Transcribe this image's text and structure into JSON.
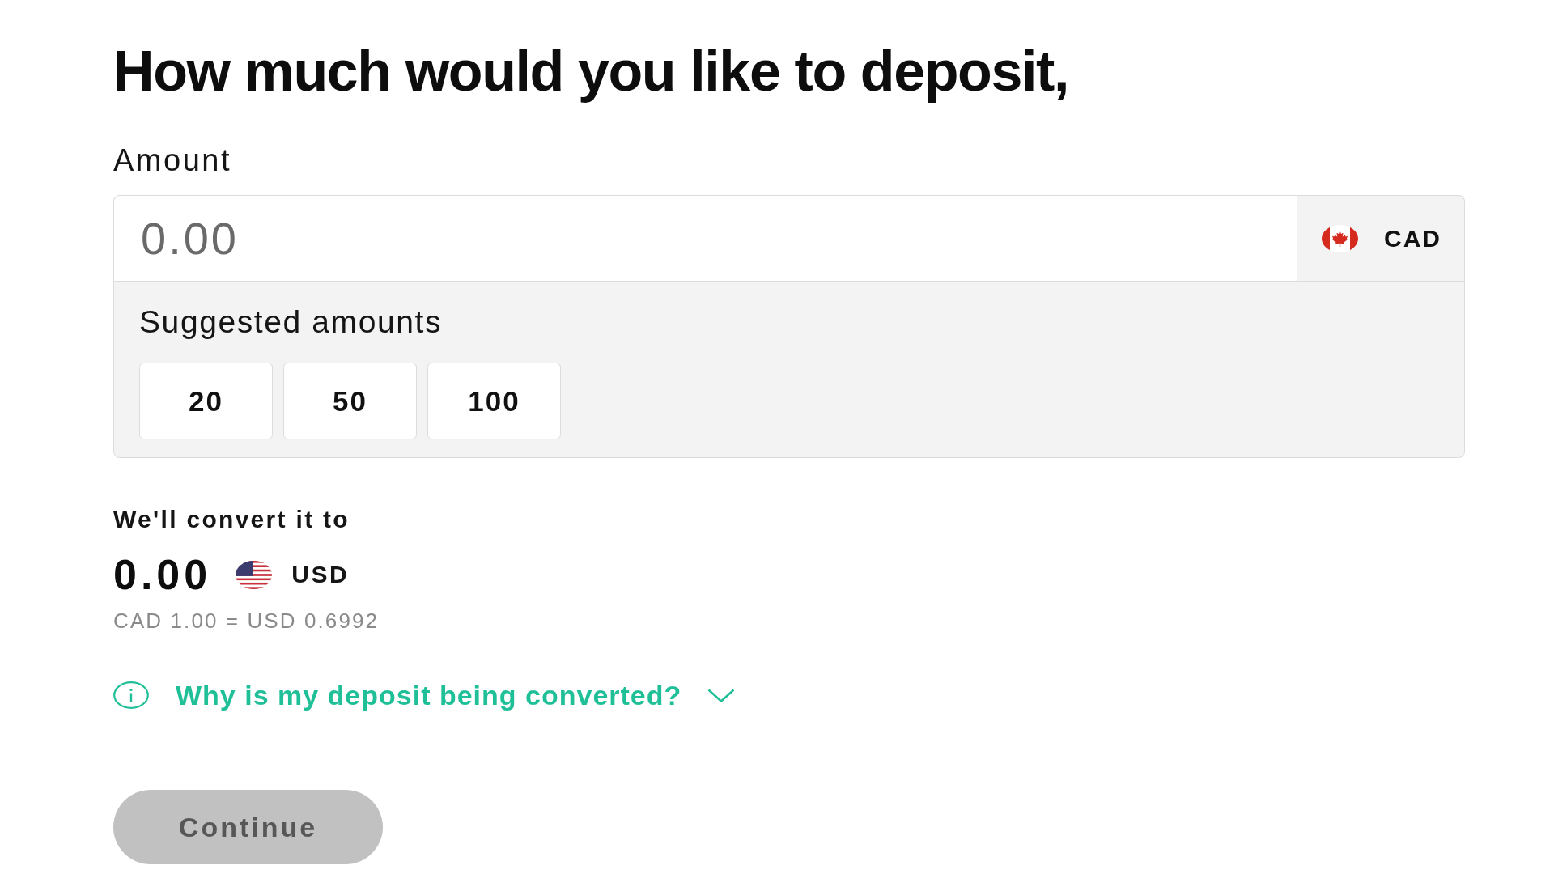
{
  "heading": "How much would you like to deposit,",
  "amount": {
    "label": "Amount",
    "placeholder": "0.00",
    "currency": "CAD"
  },
  "suggested": {
    "label": "Suggested amounts",
    "amounts": [
      "20",
      "50",
      "100"
    ]
  },
  "conversion": {
    "label": "We'll convert it to",
    "amount": "0.00",
    "currency": "USD",
    "rate": "CAD 1.00 = USD 0.6992"
  },
  "info_toggle": {
    "text": "Why is my deposit being converted?",
    "expanded": false
  },
  "continue_button": {
    "label": "Continue",
    "disabled": true
  }
}
